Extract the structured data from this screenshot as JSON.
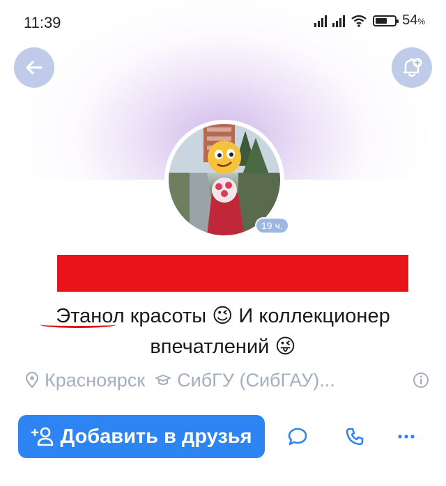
{
  "status": {
    "time": "11:39",
    "battery": "54",
    "battery_unit": "%"
  },
  "header": {
    "back_icon": "arrow-left-icon",
    "bell_icon": "bell-plus-icon"
  },
  "profile": {
    "story_age": "19 ч.",
    "bio_line1": "Этанол красоты 😉 И коллекционер",
    "bio_line2": "впечатлений 😜",
    "city": "Красноярск",
    "university": "СибГУ (СибГАУ)...",
    "redaction_color": "#e8141a"
  },
  "actions": {
    "add_friend_label": "Добавить в друзья",
    "message_icon": "message-bubble-icon",
    "call_icon": "phone-icon",
    "more_icon": "more-dots-icon"
  },
  "colors": {
    "accent": "#2f84f3",
    "muted": "#a3aec0"
  }
}
